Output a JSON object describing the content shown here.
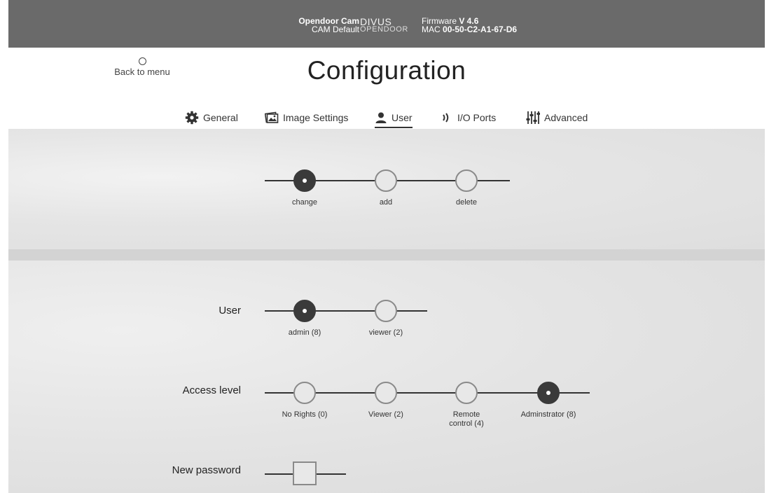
{
  "topbar": {
    "device_name": "Opendoor Cam",
    "cam_label": "CAM Default",
    "logo_line1": "DIVUS",
    "logo_line2": "OPENDOOR",
    "firmware_label": "Firmware",
    "firmware_value": "V 4.6",
    "mac_label": "MAC",
    "mac_value": "00-50-C2-A1-67-D6",
    "bg_color": "#6a6a6a"
  },
  "header": {
    "back_label": "Back to menu",
    "title": "Configuration"
  },
  "tabs": [
    {
      "label": "General",
      "icon": "gear-icon"
    },
    {
      "label": "Image Settings",
      "icon": "image-icon"
    },
    {
      "label": "User",
      "icon": "user-icon",
      "active": true
    },
    {
      "label": "I/O Ports",
      "icon": "signal-icon"
    },
    {
      "label": "Advanced",
      "icon": "sliders-icon"
    }
  ],
  "mode_selector": {
    "options": [
      "change",
      "add",
      "delete"
    ],
    "selected": "change"
  },
  "user_form": {
    "user": {
      "label": "User",
      "options": [
        "admin (8)",
        "viewer (2)"
      ],
      "selected": "admin (8)"
    },
    "access_level": {
      "label": "Access level",
      "options": [
        "No Rights (0)",
        "Viewer (2)",
        "Remote control (4)",
        "Adminstrator (8)"
      ],
      "selected": "Adminstrator (8)"
    },
    "new_password": {
      "label": "New password",
      "value": ""
    }
  }
}
